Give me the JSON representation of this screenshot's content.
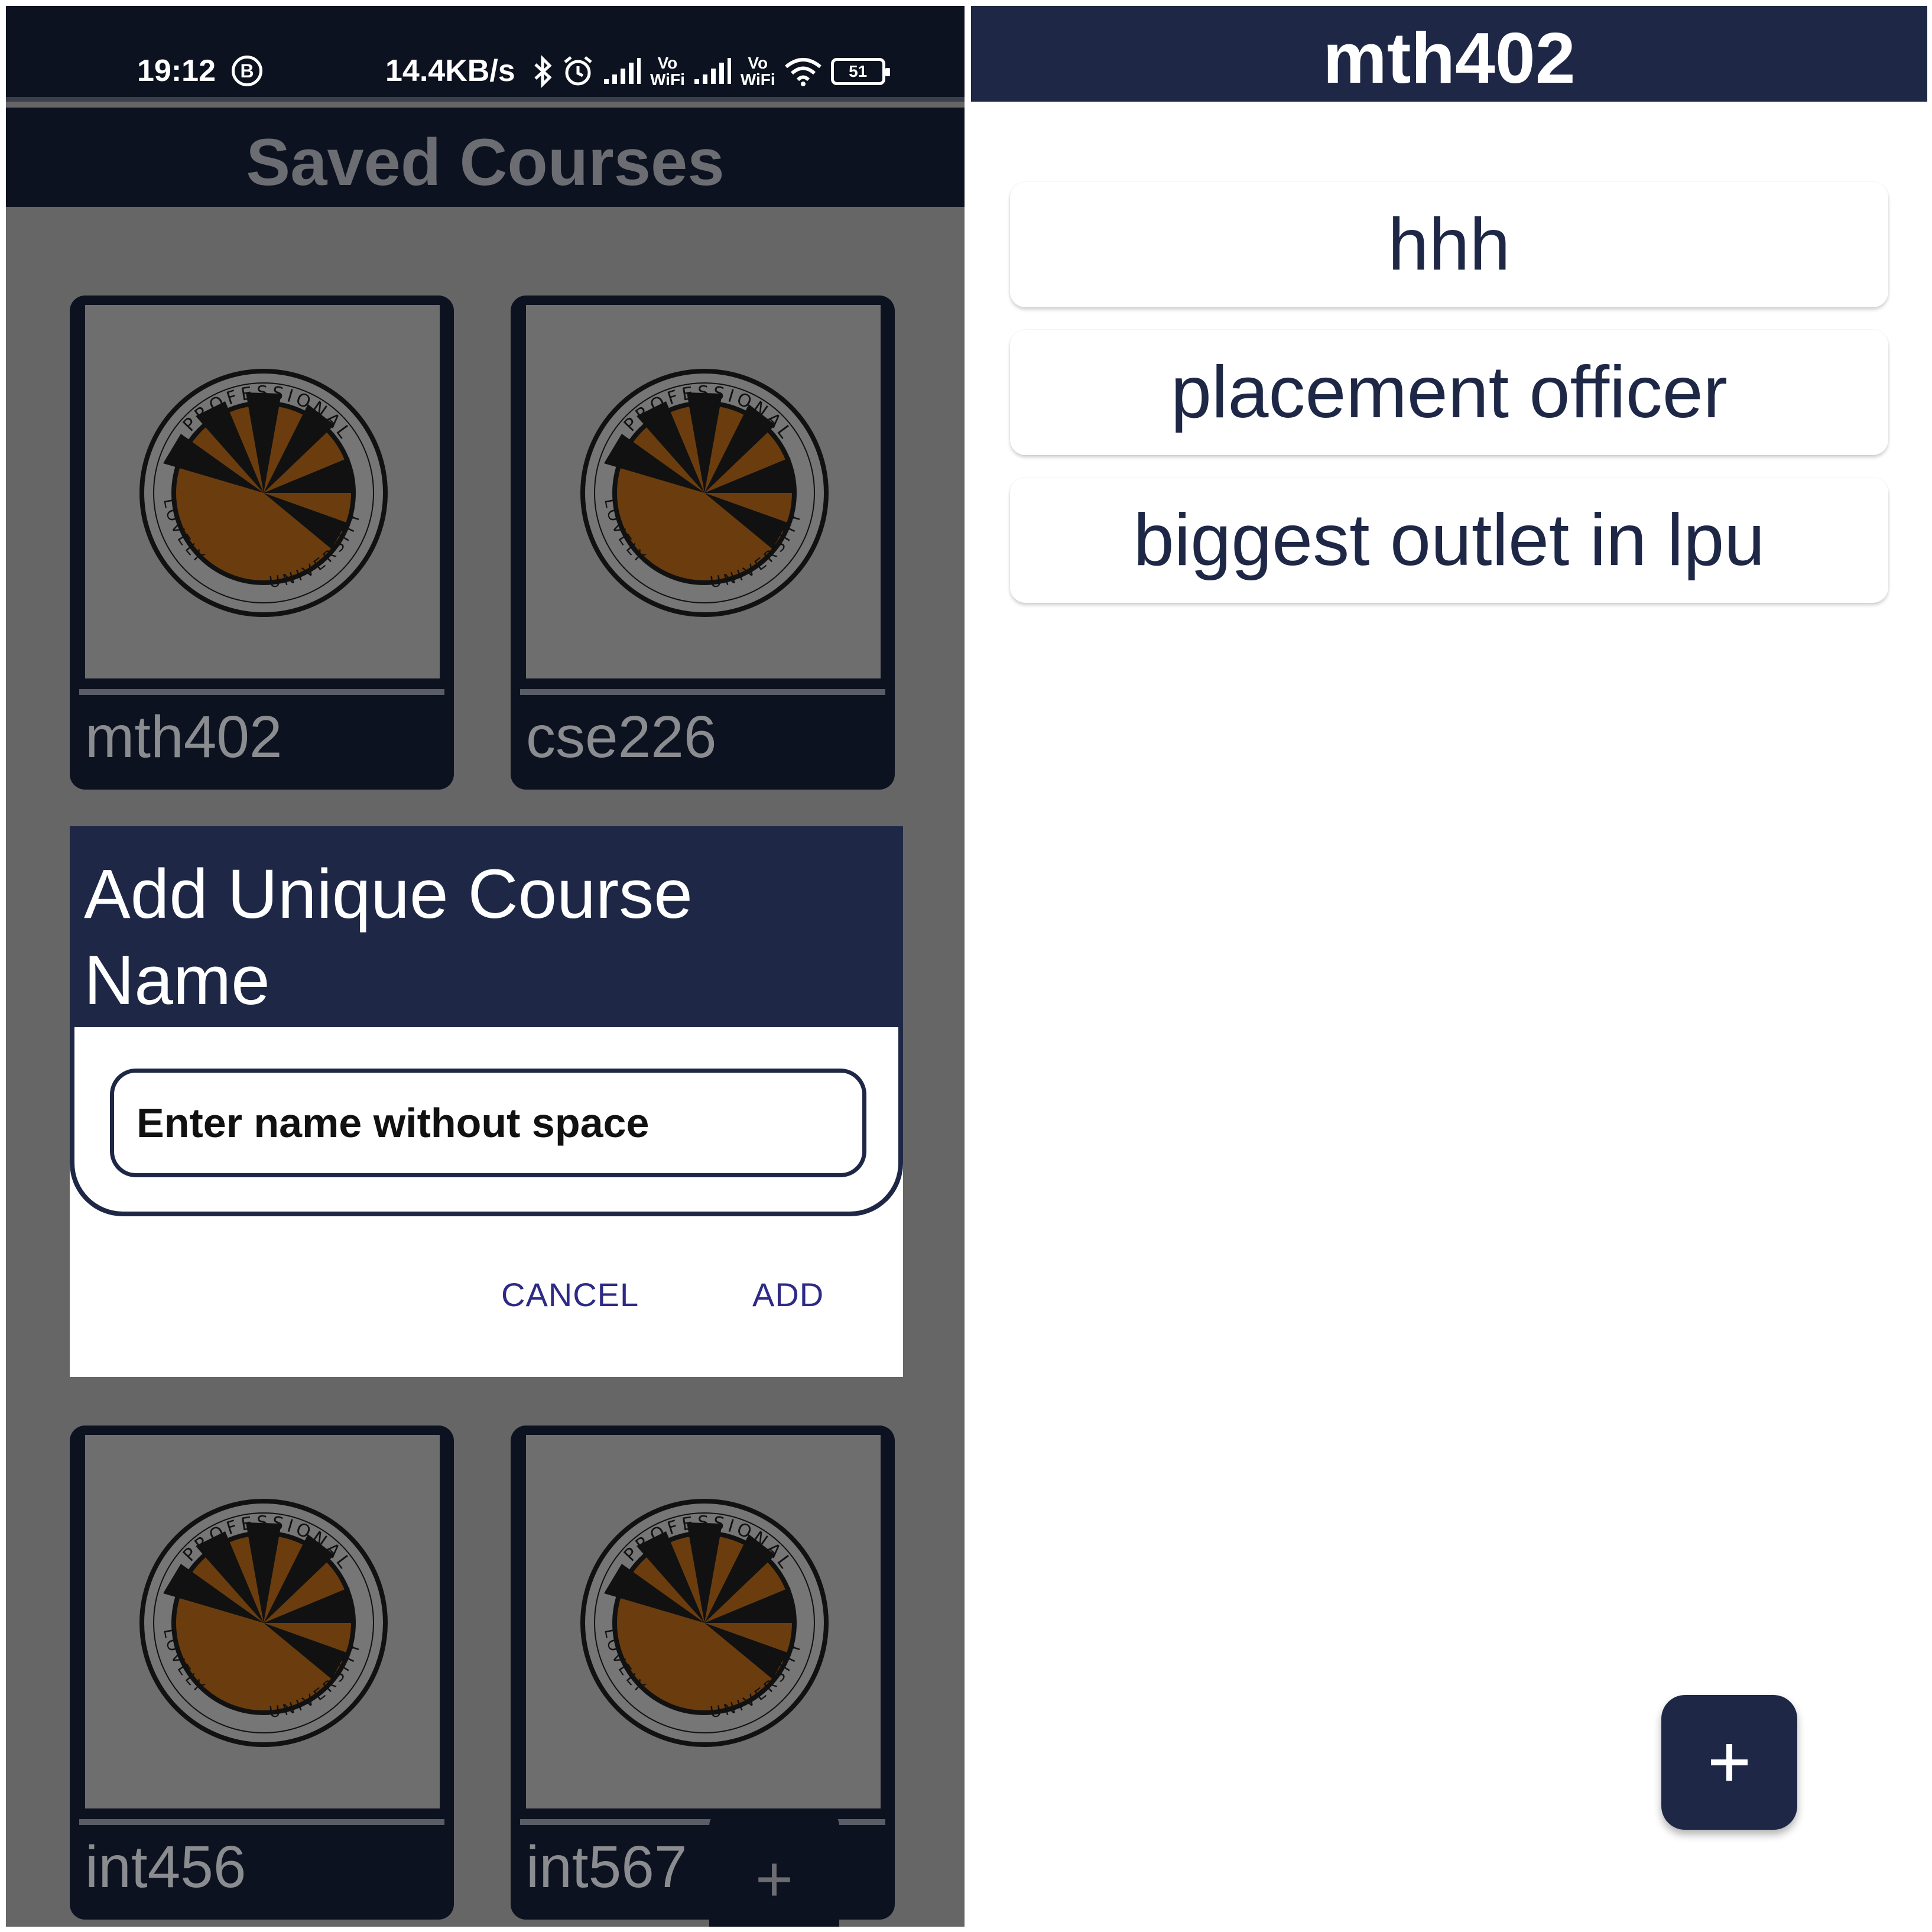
{
  "left_screen": {
    "status_bar": {
      "time": "19:12",
      "time_badge": "B",
      "net_speed": "14.4KB/s",
      "volte1_top": "Vo",
      "volte1_bottom": "WiFi",
      "volte2_top": "Vo",
      "volte2_bottom": "WiFi",
      "battery": "51"
    },
    "app_title": "Saved Courses",
    "courses": [
      {
        "name": "mth402",
        "logo": "lovely-professional-university-logo"
      },
      {
        "name": "cse226",
        "logo": "lovely-professional-university-logo"
      },
      {
        "name": "int456",
        "logo": "lovely-professional-university-logo"
      },
      {
        "name": "int567",
        "logo": "lovely-professional-university-logo"
      }
    ],
    "fab_label": "+",
    "dialog": {
      "title": "Add Unique Course Name",
      "input_placeholder": "Enter name without space",
      "input_value": "",
      "cancel_label": "CANCEL",
      "add_label": "ADD"
    }
  },
  "right_screen": {
    "app_title": "mth402",
    "items": [
      {
        "label": "hhh"
      },
      {
        "label": "placement officer"
      },
      {
        "label": "biggest outlet in lpu"
      }
    ],
    "fab_icon": "plus-icon"
  },
  "colors": {
    "navy": "#1e2846",
    "dark_bar": "#0d1220",
    "overlay_gray": "#666666",
    "dialog_button": "#2e2a86"
  },
  "logo_text": {
    "top": "PROFESSIONAL",
    "left": "LOVELY",
    "right": "UNIVERSITY"
  }
}
